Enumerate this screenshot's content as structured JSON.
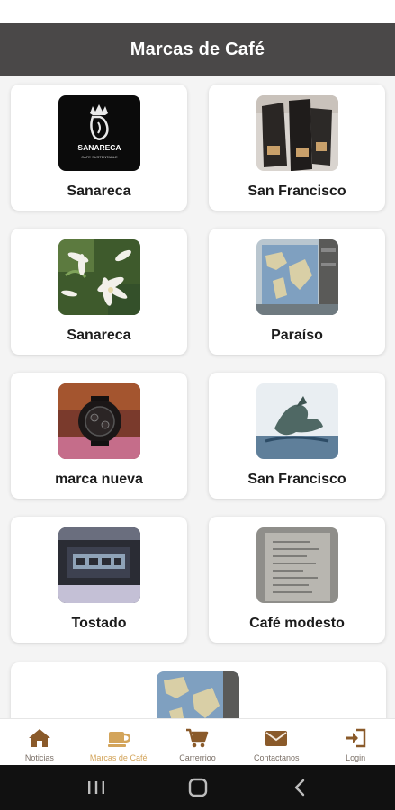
{
  "app_bar": {
    "title": "Marcas de Café"
  },
  "brands": [
    {
      "label": "Sanareca"
    },
    {
      "label": "San Francisco"
    },
    {
      "label": "Sanareca"
    },
    {
      "label": "Paraíso"
    },
    {
      "label": "marca nueva"
    },
    {
      "label": "San Francisco"
    },
    {
      "label": "Tostado"
    },
    {
      "label": "Café modesto"
    }
  ],
  "logo_text": {
    "main": "SANARECA",
    "sub": "CAFE SUSTENTABLE"
  },
  "nav": {
    "items": [
      {
        "label": "Noticias",
        "icon": "home-icon"
      },
      {
        "label": "Marcas de Café",
        "icon": "coffee-cup-icon",
        "active": true
      },
      {
        "label": "Carrerrioo",
        "icon": "cart-icon"
      },
      {
        "label": "Contactanos",
        "icon": "envelope-icon"
      },
      {
        "label": "Login",
        "icon": "login-icon"
      }
    ],
    "active_color": "#d3a45a",
    "icon_color": "#8a5a2a"
  },
  "colors": {
    "app_bar": "#4a4848",
    "background": "#f4f4f4",
    "card": "#ffffff",
    "system_nav": "#111111"
  }
}
